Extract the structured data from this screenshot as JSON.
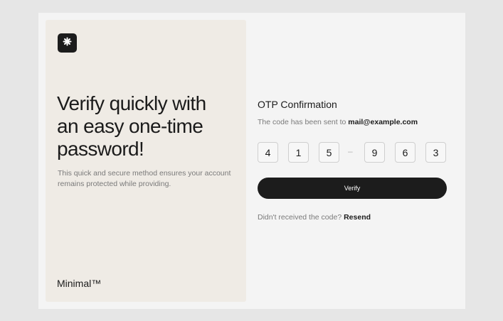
{
  "hero": {
    "logo_icon": "asterisk-icon",
    "headline": "Verify quickly with an easy one-time password!",
    "description": "This quick and secure method ensures your account remains protected while providing.",
    "brand": "Minimal™"
  },
  "otp_form": {
    "title": "OTP Confirmation",
    "sent_prefix": "The code has been sent to",
    "email": "mail@example.com",
    "digits": [
      "4",
      "1",
      "5",
      "9",
      "6",
      "3"
    ],
    "separator": "–",
    "verify_label": "Verify",
    "resend_prompt": "Didn't received the code?",
    "resend_label": "Resend"
  },
  "colors": {
    "page_background": "#e6e6e6",
    "panel_background": "#efebe5",
    "accent_dark": "#1c1c1c"
  }
}
